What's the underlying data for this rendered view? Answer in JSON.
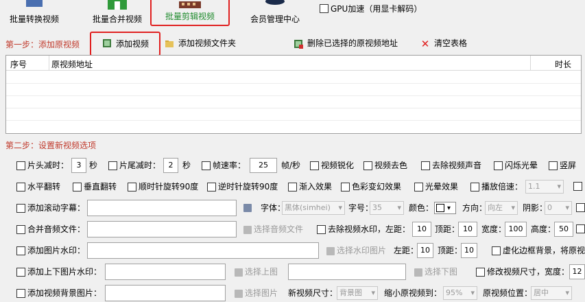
{
  "toolbar": {
    "batch_convert": "批量转换视频",
    "batch_merge": "批量合并视频",
    "batch_edit": "批量剪辑视频",
    "member": "会员管理中心",
    "gpu": "GPU加速（用显卡解码）"
  },
  "step1": {
    "label": "第一步：添加原视频",
    "add_video": "添加视频",
    "add_folder": "添加视频文件夹",
    "delete_selected": "删除已选择的原视频地址",
    "clear_table": "清空表格"
  },
  "table": {
    "col_index": "序号",
    "col_path": "原视频地址",
    "col_duration": "时长"
  },
  "step2": {
    "label": "第二步：设置新视频选项",
    "row1": {
      "head_cut": "片头减时：",
      "head_val": "3",
      "sec1": "秒",
      "tail_cut": "片尾减时：",
      "tail_val": "2",
      "sec2": "秒",
      "fps": "帧速率：",
      "fps_val": "25",
      "fps_unit": "帧/秒",
      "sharpen": "视频锐化",
      "decolor": "视频去色",
      "mute": "去除视频声音",
      "flash": "闪烁光晕",
      "vertical": "竖屏"
    },
    "row2": {
      "hflip": "水平翻转",
      "vflip": "垂直翻转",
      "cw90": "顺时针旋转90度",
      "ccw90": "逆时针旋转90度",
      "fadein": "渐入效果",
      "color": "色彩变幻效果",
      "halo": "光晕效果",
      "speed": "播放倍速：",
      "speed_val": "1.1"
    },
    "row3": {
      "scroll": "添加滚动字幕：",
      "font": "字体：",
      "font_val": "黑体(simhei)",
      "size": "字号：",
      "size_val": "35",
      "color": "颜色：",
      "direction": "方向：",
      "dir_val": "向左",
      "shadow": "阴影：",
      "shadow_val": "0"
    },
    "row4": {
      "merge_audio": "合并音频文件：",
      "select_audio": "选择音频文件",
      "remove_wm": "去除视频水印，左距：",
      "left_val": "10",
      "top": "顶距：",
      "top_val": "10",
      "width": "宽度：",
      "width_val": "100",
      "height": "高度：",
      "height_val": "50"
    },
    "row5": {
      "image_wm": "添加图片水印：",
      "select_wm": "选择水印图片",
      "left": "左距：",
      "left_val": "10",
      "top": "顶距：",
      "top_val": "10",
      "blur_bg": "虚化边框背景，将原视"
    },
    "row6": {
      "tb_wm": "添加上下图片水印：",
      "select_top": "选择上图",
      "select_bottom": "选择下图",
      "resize": "修改视频尺寸，宽度：",
      "resize_val": "12"
    },
    "row7": {
      "bg_image": "添加视频背景图片：",
      "select_img": "选择图片",
      "new_size": "新视频尺寸：",
      "new_size_val": "背景图",
      "shrink": "缩小原视频到：",
      "shrink_val": "95%",
      "position": "原视频位置：",
      "position_val": "居中"
    }
  }
}
